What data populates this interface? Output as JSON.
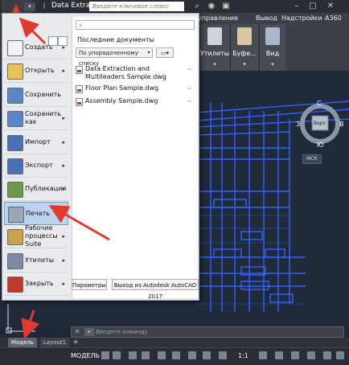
{
  "titlebar": {
    "title": "Data Extracti",
    "search_placeholder": "Введите ключевое слово/фразу",
    "menu_arrow": "▾"
  },
  "ribbon": {
    "tabs": [
      "управление",
      "Вывод",
      "Надстройки",
      "А360"
    ],
    "groups": [
      {
        "label": "Утилиты"
      },
      {
        "label": "Буфе..."
      },
      {
        "label": "Вид"
      }
    ]
  },
  "app_menu": {
    "search_placeholder": "",
    "items": [
      {
        "label": "Создать",
        "has_arrow": true,
        "color": "#f2f2f2"
      },
      {
        "label": "Открыть",
        "has_arrow": true,
        "color": "#e8c15a"
      },
      {
        "label": "Сохранить",
        "has_arrow": false,
        "color": "#5a86c7"
      },
      {
        "label": "Сохранить как",
        "has_arrow": true,
        "color": "#5a86c7"
      },
      {
        "label": "Импорт",
        "has_arrow": true,
        "color": "#4a6fb5"
      },
      {
        "label": "Экспорт",
        "has_arrow": true,
        "color": "#4a6fb5"
      },
      {
        "label": "Публикация",
        "has_arrow": true,
        "color": "#6b9a4a"
      },
      {
        "label": "Печать",
        "has_arrow": true,
        "color": "#9ba7b5",
        "active": true
      },
      {
        "label": "Рабочие процессы Suite",
        "has_arrow": true,
        "color": "#c8a34a"
      },
      {
        "label": "Утилиты",
        "has_arrow": true,
        "color": "#7a8aa0"
      },
      {
        "label": "Закрыть",
        "has_arrow": true,
        "color": "#c0392b"
      }
    ],
    "recent_title": "Последние документы",
    "sort_label": "По упорядоченному списку",
    "recent_docs": [
      {
        "name": "Data Extraction and Multileaders Sample.dwg"
      },
      {
        "name": "Floor Plan Sample.dwg"
      },
      {
        "name": "Assembly Sample.dwg"
      }
    ],
    "options_label": "Параметры",
    "exit_label": "Выход из Autodesk AutoCAD 2017"
  },
  "navcube": {
    "north": "С",
    "south": "Ю",
    "west": "З",
    "east": "В",
    "face": "Верх",
    "msk": "МСК"
  },
  "cmdline": {
    "placeholder": "Введите команду"
  },
  "layout_tabs": {
    "model": "Модель",
    "layout1": "Layout1",
    "add": "+"
  },
  "statusbar": {
    "model": "МОДЕЛЬ",
    "scale": "1:1"
  },
  "colors": {
    "drawing_line": "#2f63ff",
    "annotation_arrow": "#e03a2f",
    "canvas_bg": "#202a3a",
    "active_item": "#bcd3ee"
  }
}
